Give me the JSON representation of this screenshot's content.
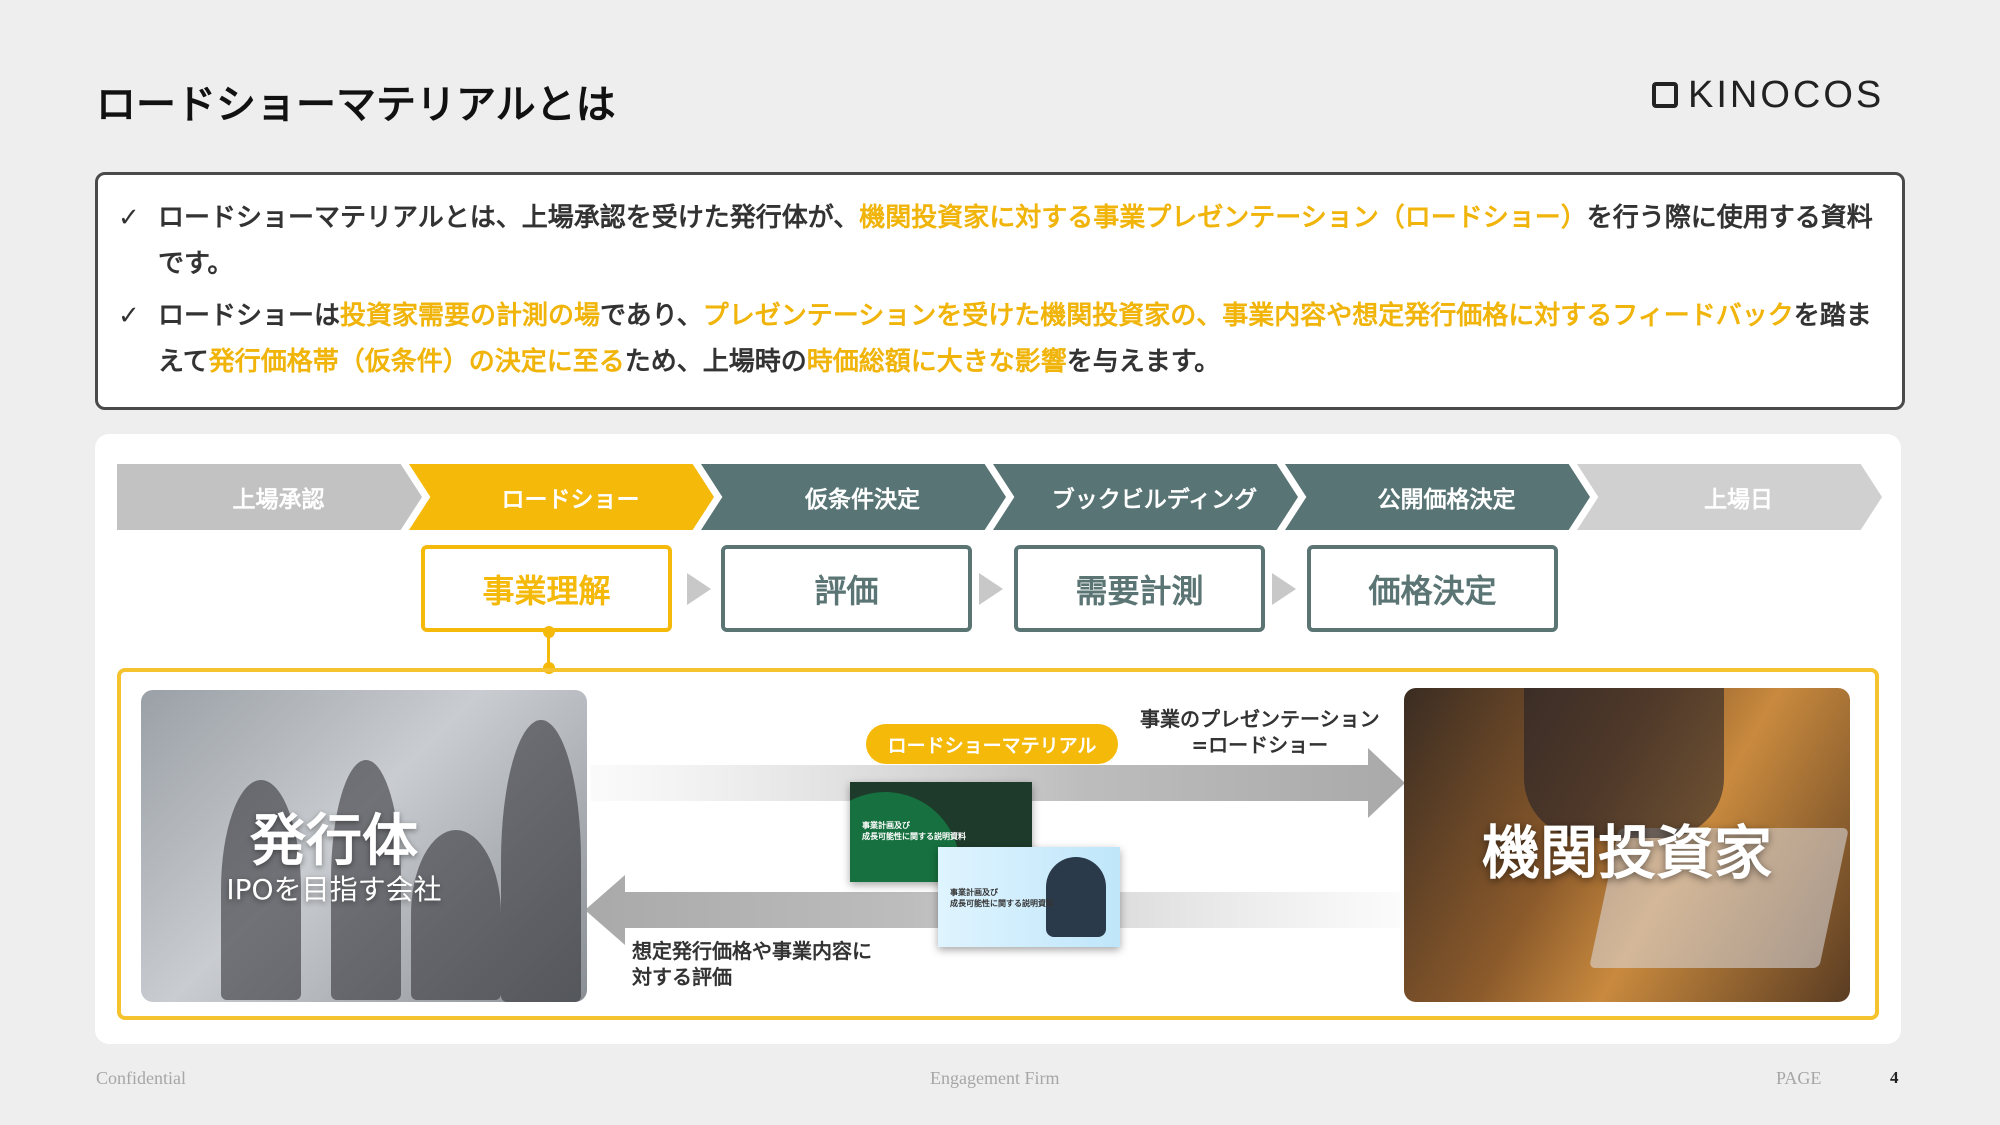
{
  "header": {
    "title": "ロードショーマテリアルとは",
    "logo_text": "KINOCOS"
  },
  "summary": {
    "bullets": [
      {
        "check": "✓",
        "parts": [
          {
            "text": "ロードショーマテリアルとは、上場承認を受けた発行体が、",
            "hl": false
          },
          {
            "text": "機関投資家に対する事業プレゼンテーション（ロードショー）",
            "hl": true
          },
          {
            "text": "を行う際に使用する資料です。",
            "hl": false
          }
        ]
      },
      {
        "check": "✓",
        "parts": [
          {
            "text": "ロードショーは",
            "hl": false
          },
          {
            "text": "投資家需要の計測の場",
            "hl": true
          },
          {
            "text": "であり、",
            "hl": false
          },
          {
            "text": "プレゼンテーションを受けた機関投資家の、事業内容や想定発行価格に対するフィードバック",
            "hl": true
          },
          {
            "text": "を踏まえて",
            "hl": false
          },
          {
            "text": "発行価格帯（仮条件）の決定に至る",
            "hl": true
          },
          {
            "text": "ため、上場時の",
            "hl": false
          },
          {
            "text": "時価総額に大きな影響",
            "hl": true
          },
          {
            "text": "を与えます。",
            "hl": false
          }
        ]
      }
    ]
  },
  "process": {
    "steps": [
      {
        "label": "上場承認",
        "color": "#c2c2c2"
      },
      {
        "label": "ロードショー",
        "color": "#f5b90a"
      },
      {
        "label": "仮条件決定",
        "color": "#587474"
      },
      {
        "label": "ブックビルディング",
        "color": "#587474"
      },
      {
        "label": "公開価格決定",
        "color": "#587474"
      },
      {
        "label": "上場日",
        "color": "#d0d0d0"
      }
    ],
    "phases": [
      "事業理解",
      "評価",
      "需要計測",
      "価格決定"
    ]
  },
  "diagram": {
    "issuer_title": "発行体",
    "issuer_subtitle": "IPOを目指す会社",
    "investor_title": "機関投資家",
    "material_label": "ロードショーマテリアル",
    "presentation_label_1": "事業のプレゼンテーション",
    "presentation_label_2": "=ロードショー",
    "feedback_label_1": "想定発行価格や事業内容に",
    "feedback_label_2": "対する評価",
    "doc1_text_1": "事業計画及び",
    "doc1_text_2": "成長可能性に関する説明資料",
    "doc2_text_1": "事業計画及び",
    "doc2_text_2": "成長可能性に関する説明資料"
  },
  "footer": {
    "left": "Confidential",
    "center": "Engagement Firm",
    "page_label": "PAGE",
    "page_number": "4"
  }
}
